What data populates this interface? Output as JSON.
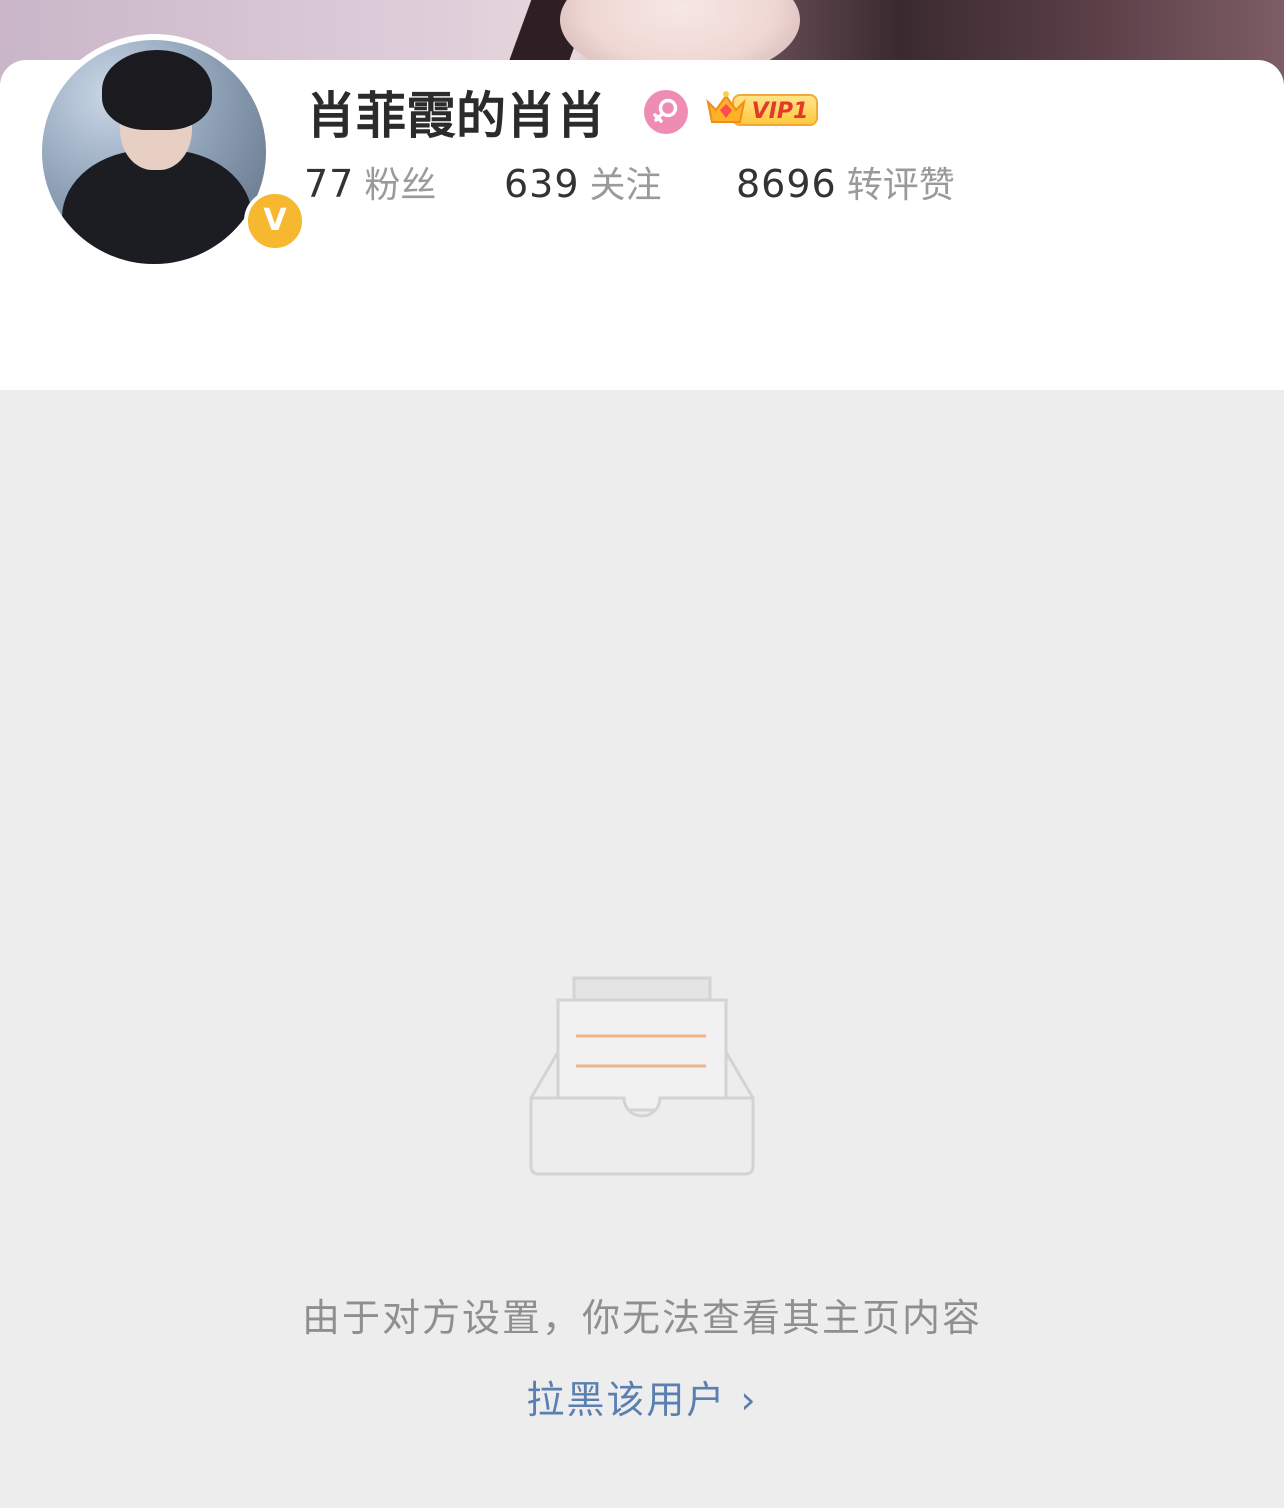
{
  "profile": {
    "name": "肖菲霞的肖肖",
    "gender_icon": "female-icon",
    "verified_icon": "v-verified-icon",
    "verified_label": "V",
    "vip_label": "VIP1",
    "stats": [
      {
        "value": "77",
        "label": "粉丝"
      },
      {
        "value": "639",
        "label": "关注"
      },
      {
        "value": "8696",
        "label": "转评赞"
      }
    ]
  },
  "empty_state": {
    "icon": "empty-box-icon",
    "message": "由于对方设置，你无法查看其主页内容",
    "action_label": "拉黑该用户",
    "action_chevron": "›"
  },
  "colors": {
    "link": "#5a7fb0",
    "verified": "#f5b82e",
    "female": "#ef8cb3",
    "background": "#ededed"
  }
}
